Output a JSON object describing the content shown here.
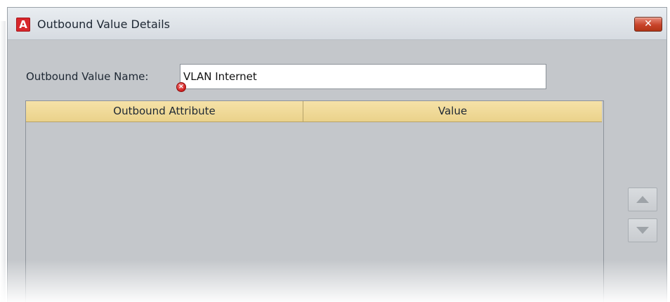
{
  "window": {
    "app_icon_letter": "A",
    "title": "Outbound Value Details",
    "close_symbol": "✕"
  },
  "form": {
    "name_label": "Outbound Value Name:",
    "name_value": "VLAN Internet",
    "error_icon": "error-icon",
    "error_symbol": "×"
  },
  "grid": {
    "columns": [
      "Outbound Attribute",
      "Value"
    ],
    "rows": []
  },
  "reorder": {
    "up_icon": "triangle-up-icon",
    "down_icon": "triangle-down-icon"
  }
}
